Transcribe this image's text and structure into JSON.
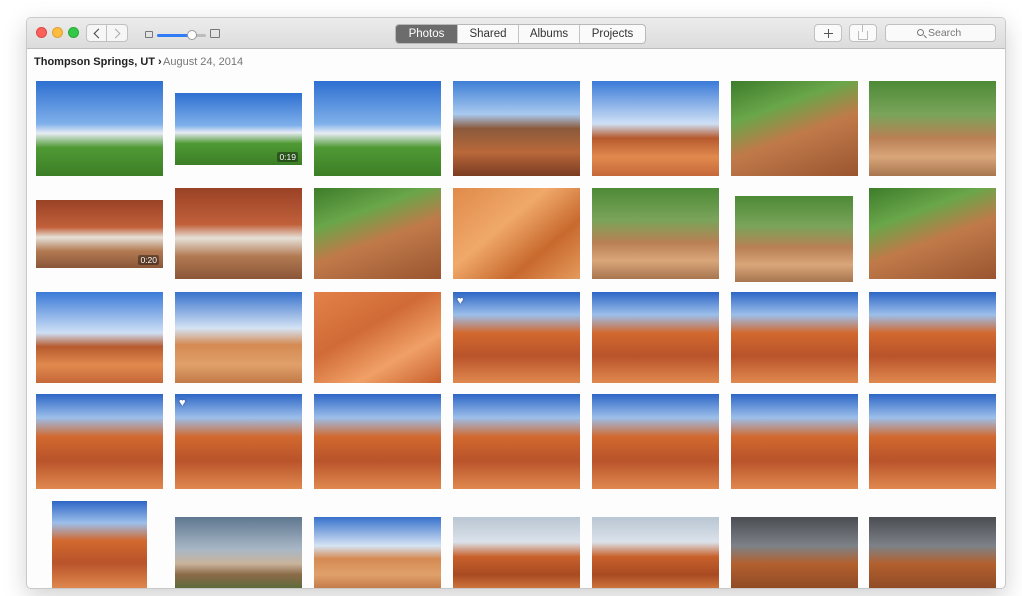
{
  "toolbar": {
    "tabs": [
      {
        "label": "Photos",
        "active": true
      },
      {
        "label": "Shared",
        "active": false
      },
      {
        "label": "Albums",
        "active": false
      },
      {
        "label": "Projects",
        "active": false
      }
    ],
    "zoom_level": 0.72,
    "search_placeholder": "Search",
    "accent": "#2f7cf6"
  },
  "header": {
    "location": "Thompson Springs, UT ›",
    "date": "August 24, 2014"
  },
  "photos": [
    {
      "row": 0,
      "col": 0,
      "theme": "field-sky"
    },
    {
      "row": 0,
      "col": 1,
      "theme": "field-sky",
      "duration": "0:19"
    },
    {
      "row": 0,
      "col": 2,
      "theme": "field-sky"
    },
    {
      "row": 0,
      "col": 3,
      "theme": "canyon-sky"
    },
    {
      "row": 0,
      "col": 4,
      "theme": "mesa-sky"
    },
    {
      "row": 0,
      "col": 5,
      "theme": "green-rock"
    },
    {
      "row": 0,
      "col": 6,
      "theme": "stream"
    },
    {
      "row": 1,
      "col": 0,
      "theme": "waterfall",
      "duration": "0:20"
    },
    {
      "row": 1,
      "col": 1,
      "theme": "waterfall"
    },
    {
      "row": 1,
      "col": 2,
      "theme": "green-rock"
    },
    {
      "row": 1,
      "col": 3,
      "theme": "sand"
    },
    {
      "row": 1,
      "col": 4,
      "theme": "stream"
    },
    {
      "row": 1,
      "col": 5,
      "theme": "stream"
    },
    {
      "row": 1,
      "col": 6,
      "theme": "green-rock"
    },
    {
      "row": 2,
      "col": 0,
      "theme": "mesa-sky"
    },
    {
      "row": 2,
      "col": 1,
      "theme": "desert-sky"
    },
    {
      "row": 2,
      "col": 2,
      "theme": "slickrock"
    },
    {
      "row": 2,
      "col": 3,
      "theme": "arch",
      "favorite": true
    },
    {
      "row": 2,
      "col": 4,
      "theme": "arch"
    },
    {
      "row": 2,
      "col": 5,
      "theme": "arch"
    },
    {
      "row": 2,
      "col": 6,
      "theme": "arch"
    },
    {
      "row": 3,
      "col": 0,
      "theme": "arch"
    },
    {
      "row": 3,
      "col": 1,
      "theme": "arch",
      "favorite": true
    },
    {
      "row": 3,
      "col": 2,
      "theme": "arch"
    },
    {
      "row": 3,
      "col": 3,
      "theme": "arch"
    },
    {
      "row": 3,
      "col": 4,
      "theme": "arch"
    },
    {
      "row": 3,
      "col": 5,
      "theme": "arch"
    },
    {
      "row": 3,
      "col": 6,
      "theme": "arch"
    },
    {
      "row": 4,
      "col": 0,
      "theme": "arch"
    },
    {
      "row": 4,
      "col": 1,
      "theme": "storm-plain"
    },
    {
      "row": 4,
      "col": 2,
      "theme": "desert-sky"
    },
    {
      "row": 4,
      "col": 3,
      "theme": "hoodoos"
    },
    {
      "row": 4,
      "col": 4,
      "theme": "hoodoos"
    },
    {
      "row": 4,
      "col": 5,
      "theme": "dark-hoodoos"
    },
    {
      "row": 4,
      "col": 6,
      "theme": "dark-hoodoos"
    }
  ]
}
